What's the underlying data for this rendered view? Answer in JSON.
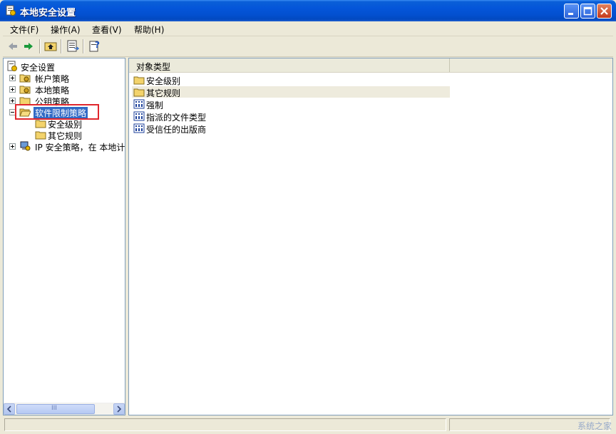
{
  "window": {
    "title": "本地安全设置"
  },
  "menu": [
    "文件(F)",
    "操作(A)",
    "查看(V)",
    "帮助(H)"
  ],
  "tree": {
    "root": "安全设置",
    "account_policy": "帐户策略",
    "local_policy": "本地策略",
    "public_key_policy": "公钥策略",
    "software_restriction": "软件限制策略",
    "security_levels": "安全级别",
    "other_rules": "其它规则",
    "ip_security": "IP 安全策略，在 本地计"
  },
  "list": {
    "column_header": "对象类型",
    "items": [
      "安全级别",
      "其它规则",
      "强制",
      "指派的文件类型",
      "受信任的出版商"
    ]
  },
  "scrollbar": {
    "thumb_glyph": "III"
  },
  "watermark": "系统之家"
}
